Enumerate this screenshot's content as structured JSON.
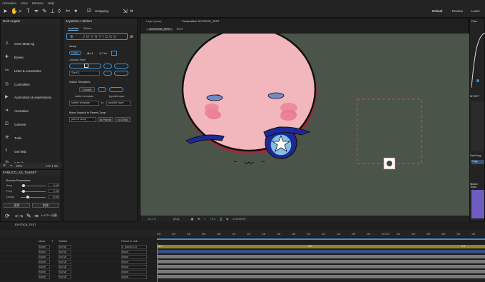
{
  "menu": [
    "Animation",
    "View",
    "Window",
    "Help"
  ],
  "toolbar": {
    "snapping": "Snapping",
    "workspaces": [
      "Default",
      "Review",
      "Learn"
    ]
  },
  "duik": {
    "title": "Duik Angela",
    "items": [
      "OCO Meta-rig",
      "Bones",
      "Links & constraints",
      "Controllers",
      "Automation & expressions",
      "Animation",
      "Camera",
      "Tools",
      "Get help",
      "♥ Duik"
    ],
    "zoom": "20%",
    "version": "v17.1.20"
  },
  "famuco": {
    "title": "FAMUCO_AE_ToolSET",
    "section": "Bounce Parameters",
    "params": [
      {
        "label": "Amp",
        "value": "0.03"
      },
      {
        "label": "Freq",
        "value": "2.00"
      },
      {
        "label": "Decay",
        "value": "6.00"
      }
    ],
    "buttons": [
      "適用",
      "削除"
    ],
    "footer": "レイヤー分割"
  },
  "joysticks": {
    "tab": "Joysticks n Sliders",
    "subtabs": [
      "Joysticks",
      "Sliders"
    ],
    "logo": "JOYSTICKS",
    "setup": "Setup",
    "origin_label": "Origin:",
    "origin_opts": [
      "All",
      "Flat"
    ],
    "joystick_style": "Joystick Style",
    "style_select": "Size01",
    "switch_templates": "Switch Templates",
    "create": "Create",
    "switch_template": "switch template",
    "joystick_layer": "joystick layer",
    "switch_template_sel": "switch template",
    "joystick_layer_sel": "joystick layer",
    "to": "to",
    "move_label": "Move Joystick to Parent Comp",
    "parent_comp": "parent comp",
    "to_parent": "to Parent",
    "to_child": "to Child"
  },
  "comp": {
    "tabs": [
      "Layer (none)",
      "Composition JOYSTICK_TEST"
    ],
    "subtabs": [
      "JOYSTICK_TEST",
      "TEST"
    ],
    "zoom": "43.2 %",
    "quality": "(Full)",
    "timecode": "0:00:00:00",
    "offset": "+0.0"
  },
  "right": {
    "flow": "Flow",
    "myset": "MYSET",
    "davcopy": "DavCopy",
    "copy_btn": "Copy",
    "motion_tools": "Motion Tools"
  },
  "timeline": {
    "tab": "JOYSTICK_TEST",
    "headers": [
      "Mode",
      "T",
      "TrkMat",
      "Parent & Link"
    ],
    "rows": [
      {
        "mode": "Norm",
        "trk": "No Mt",
        "parent": "2. Box01-Co"
      },
      {
        "mode": "Norm",
        "trk": "No Mt",
        "parent": "None"
      },
      {
        "mode": "Norm",
        "trk": "No Mt",
        "parent": "None"
      },
      {
        "mode": "Norm",
        "trk": "No Mt",
        "parent": "None"
      },
      {
        "mode": "Norm",
        "trk": "No Mt",
        "parent": "None"
      },
      {
        "mode": "Norm",
        "trk": "No Mt",
        "parent": "None"
      },
      {
        "mode": "Norm",
        "trk": "No Mt",
        "parent": "None"
      }
    ],
    "ruler": [
      "00f",
      "02f",
      "04f",
      "06f",
      "08f",
      "10f",
      "12f",
      "14f",
      "16f",
      "18f",
      "20f",
      "22f",
      "24f",
      "26f",
      "28f",
      "00:00f",
      "02f",
      "04f",
      "06f",
      "08f",
      "10f",
      "12f"
    ],
    "markers": [
      "2.1",
      "2.2",
      "2.2"
    ]
  }
}
